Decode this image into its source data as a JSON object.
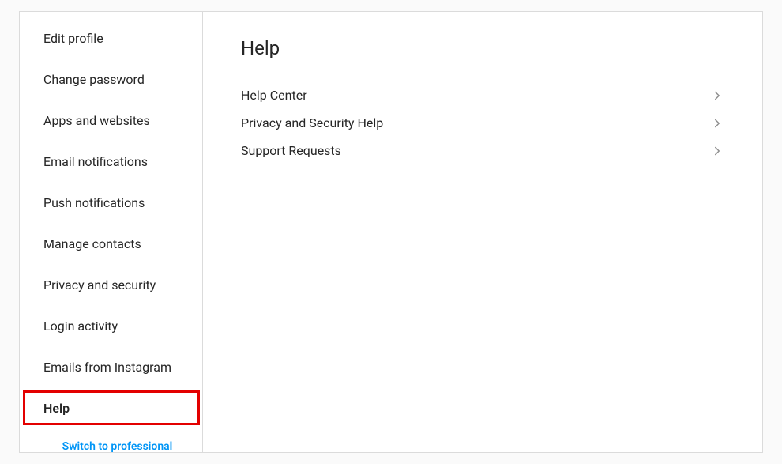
{
  "sidebar": {
    "items": [
      {
        "label": "Edit profile",
        "active": false
      },
      {
        "label": "Change password",
        "active": false
      },
      {
        "label": "Apps and websites",
        "active": false
      },
      {
        "label": "Email notifications",
        "active": false
      },
      {
        "label": "Push notifications",
        "active": false
      },
      {
        "label": "Manage contacts",
        "active": false
      },
      {
        "label": "Privacy and security",
        "active": false
      },
      {
        "label": "Login activity",
        "active": false
      },
      {
        "label": "Emails from Instagram",
        "active": false
      },
      {
        "label": "Help",
        "active": true
      }
    ],
    "switch_label": "Switch to professional"
  },
  "main": {
    "title": "Help",
    "links": [
      {
        "label": "Help Center"
      },
      {
        "label": "Privacy and Security Help"
      },
      {
        "label": "Support Requests"
      }
    ]
  }
}
